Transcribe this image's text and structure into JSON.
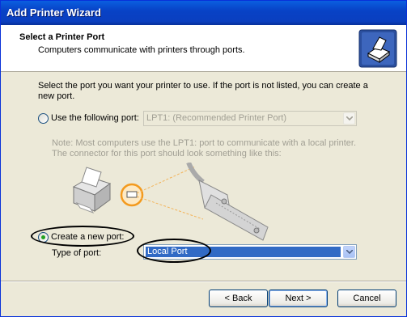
{
  "window": {
    "title": "Add Printer Wizard"
  },
  "header": {
    "title": "Select a Printer Port",
    "subtitle": "Computers communicate with printers through ports."
  },
  "body": {
    "description": "Select the port you want your printer to use.  If the port is not listed, you can create a new port.",
    "use_port": {
      "label": "Use the following port:",
      "selected": false,
      "value": "LPT1: (Recommended Printer Port)"
    },
    "note": "Note: Most computers use the LPT1: port to communicate with a local printer. The connector for this port should look something like this:",
    "create_port": {
      "label": "Create a new port:",
      "selected": true,
      "type_label": "Type of port:",
      "value": "Local Port"
    }
  },
  "buttons": {
    "back": "< Back",
    "next": "Next >",
    "cancel": "Cancel"
  },
  "colors": {
    "title_bar": "#0842c6",
    "selection": "#316ac5",
    "face": "#ece9d8"
  },
  "icons": [
    "printer-wizard-icon",
    "printer-illustration-icon",
    "parallel-connector-icon",
    "dropdown-arrow-icon"
  ]
}
